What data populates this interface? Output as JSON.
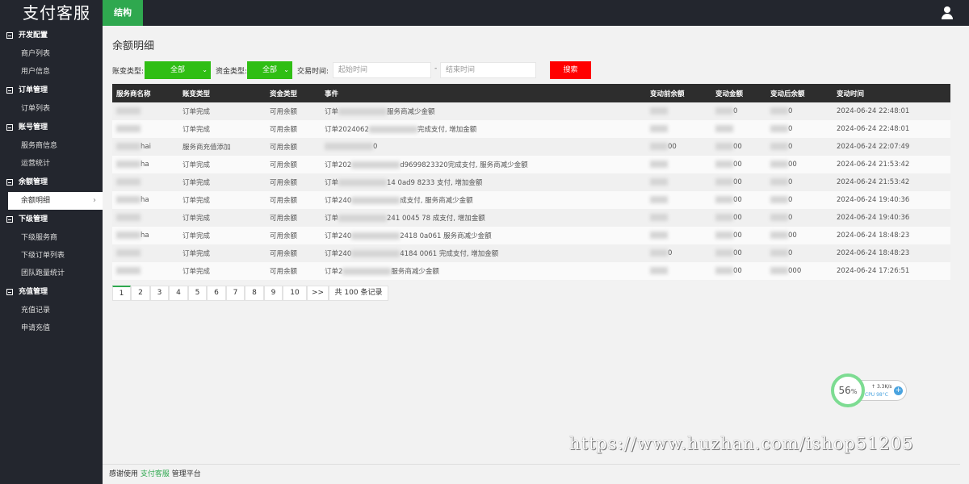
{
  "header": {
    "logo": "支付客服",
    "tab": "结构"
  },
  "sidebar": {
    "groups": [
      {
        "title": "开发配置",
        "items": [
          "商户列表",
          "用户信息"
        ]
      },
      {
        "title": "订单管理",
        "items": [
          "订单列表"
        ]
      },
      {
        "title": "账号管理",
        "items": [
          "服务商信息",
          "运营统计"
        ]
      },
      {
        "title": "余额管理",
        "items": [
          "余额明细"
        ]
      },
      {
        "title": "下级管理",
        "items": [
          "下级服务商",
          "下级订单列表",
          "团队跑量统计"
        ]
      },
      {
        "title": "充值管理",
        "items": [
          "充值记录",
          "申请充值"
        ]
      }
    ]
  },
  "page": {
    "title": "余额明细"
  },
  "filters": {
    "type_label": "账变类型:",
    "type_value": "全部",
    "fund_label": "资金类型:",
    "fund_value": "全部",
    "time_label": "交易时间:",
    "start_placeholder": "起始时间",
    "dash": "-",
    "end_placeholder": "结束时间",
    "search_label": "搜索"
  },
  "table": {
    "headers": [
      "服务商名称",
      "账变类型",
      "资金类型",
      "事件",
      "变动前余额",
      "变动金额",
      "变动后余额",
      "变动时间"
    ],
    "rows": [
      {
        "name": "",
        "type": "订单完成",
        "fund": "可用余额",
        "event": "订单",
        "event_tail": "服务商减少金额",
        "before": "",
        "amount": "0",
        "after": "0",
        "time": "2024-06-24 22:48:01"
      },
      {
        "name": "",
        "type": "订单完成",
        "fund": "可用余额",
        "event": "订单2024062",
        "event_tail": "完成支付, 增加金额",
        "before": "",
        "amount": "",
        "after": "0",
        "time": "2024-06-24 22:48:01"
      },
      {
        "name": "hai",
        "type": "服务商充值添加",
        "fund": "可用余额",
        "event": "",
        "event_tail": "0",
        "before": "00",
        "amount": "00",
        "after": "0",
        "time": "2024-06-24 22:07:49"
      },
      {
        "name": "ha",
        "type": "订单完成",
        "fund": "可用余额",
        "event": "订单202",
        "event_tail": "d9699823320完成支付, 服务商减少金额",
        "before": "",
        "amount": "00",
        "after": "00",
        "time": "2024-06-24 21:53:42"
      },
      {
        "name": "",
        "type": "订单完成",
        "fund": "可用余额",
        "event": "订单",
        "event_tail": "14   0ad9  8233  支付, 增加金额",
        "before": "",
        "amount": "00",
        "after": "0",
        "time": "2024-06-24 21:53:42"
      },
      {
        "name": "ha",
        "type": "订单完成",
        "fund": "可用余额",
        "event": "订单240",
        "event_tail": "成支付, 服务商减少金额",
        "before": "",
        "amount": "00",
        "after": "0",
        "time": "2024-06-24 19:40:36"
      },
      {
        "name": "",
        "type": "订单完成",
        "fund": "可用余额",
        "event": "订单",
        "event_tail": "241  0045  78  成支付, 增加金额",
        "before": "",
        "amount": "00",
        "after": "0",
        "time": "2024-06-24 19:40:36"
      },
      {
        "name": "ha",
        "type": "订单完成",
        "fund": "可用余额",
        "event": "订单240",
        "event_tail": "2418  0a061  服务商减少金额",
        "before": "",
        "amount": "00",
        "after": "00",
        "time": "2024-06-24 18:48:23"
      },
      {
        "name": "",
        "type": "订单完成",
        "fund": "可用余额",
        "event": "订单240",
        "event_tail": "4184  0061  完成支付, 增加金额",
        "before": "0",
        "amount": "00",
        "after": "0",
        "time": "2024-06-24 18:48:23"
      },
      {
        "name": "",
        "type": "订单完成",
        "fund": "可用余额",
        "event": "订单2",
        "event_tail": "服务商减少金额",
        "before": "",
        "amount": "00",
        "after": "000",
        "time": "2024-06-24 17:26:51"
      }
    ]
  },
  "pager": {
    "pages": [
      "1",
      "2",
      "3",
      "4",
      "5",
      "6",
      "7",
      "8",
      "9",
      "10"
    ],
    "next": ">>",
    "total": "共 100 条记录"
  },
  "widget": {
    "percent": "56",
    "percent_unit": "%",
    "net": "3.3K/s",
    "cpu": "CPU 98°C",
    "plus": "+"
  },
  "watermark": "https://www.huzhan.com/ishop51205",
  "footer": {
    "prefix": "感谢使用 ",
    "brand": "支付客服",
    "suffix": " 管理平台"
  },
  "colors": {
    "accent": "#2fa84f",
    "select": "#2fbe14",
    "search": "#ff0000",
    "dark": "#23262e"
  }
}
